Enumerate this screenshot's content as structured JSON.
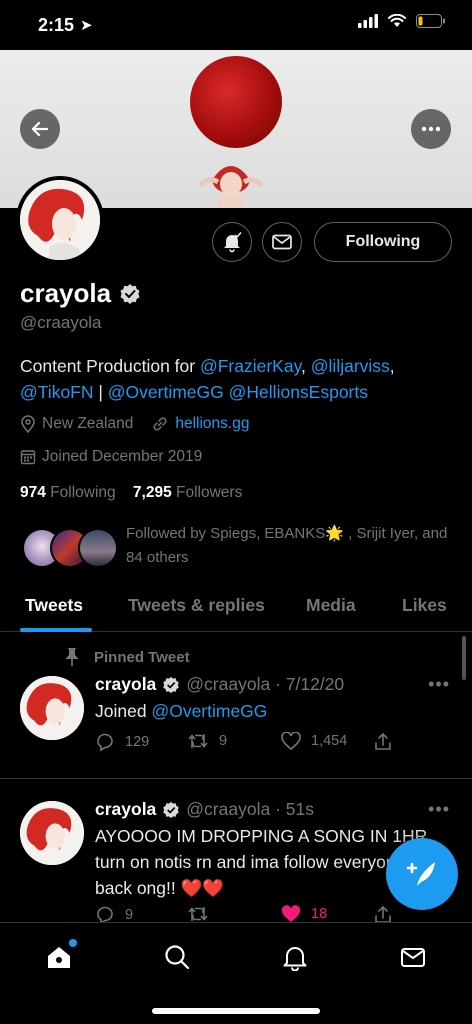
{
  "status_bar": {
    "time": "2:15",
    "location_glyph": "➤"
  },
  "profile": {
    "name": "crayola",
    "handle": "@craayola",
    "following_button": "Following",
    "bio": {
      "prefix": "Content Production for ",
      "m1": "@FrazierKay",
      "sep1": ", ",
      "m2": "@liljarviss",
      "sep2": ",",
      "m3": "@TikoFN",
      "sep3": " | ",
      "m4": "@OvertimeGG",
      "sep4": " ",
      "m5": "@HellionsEsports"
    },
    "location": "New Zealand",
    "website": "hellions.gg",
    "joined": "Joined December 2019",
    "following_count": "974",
    "following_label": "Following",
    "followers_count": "7,295",
    "followers_label": "Followers",
    "followed_by": "Followed by Spiegs, EBANKS🌟 , Srijit Iyer, and 84 others"
  },
  "tabs": [
    {
      "label": "Tweets"
    },
    {
      "label": "Tweets & replies"
    },
    {
      "label": "Media"
    },
    {
      "label": "Likes"
    }
  ],
  "tweets": [
    {
      "pinned_label": "Pinned Tweet",
      "name": "crayola",
      "handle_time": "@craayola · 7/12/20",
      "text_prefix": "Joined ",
      "text_mention": "@OvertimeGG",
      "replies": "129",
      "retweets": "9",
      "likes": "1,454"
    },
    {
      "name": "crayola",
      "handle_time": "@craayola · 51s",
      "text": "AYOOOO IM DROPPING A SONG IN 1HR turn on notis rn and ima follow everyone back ong!! ❤️❤️",
      "replies": "9",
      "retweets": "",
      "likes": "18"
    }
  ],
  "colors": {
    "accent": "#1d9bf0",
    "like": "#f91880",
    "muted": "#71767b"
  },
  "icons": [
    "back-arrow-icon",
    "more-icon",
    "notification-bell-icon",
    "message-envelope-icon",
    "verified-badge-icon",
    "location-pin-icon",
    "link-icon",
    "calendar-icon",
    "pin-icon",
    "reply-icon",
    "retweet-icon",
    "heart-icon",
    "share-icon",
    "compose-feather-icon",
    "home-icon",
    "search-icon",
    "notifications-icon",
    "messages-icon"
  ]
}
